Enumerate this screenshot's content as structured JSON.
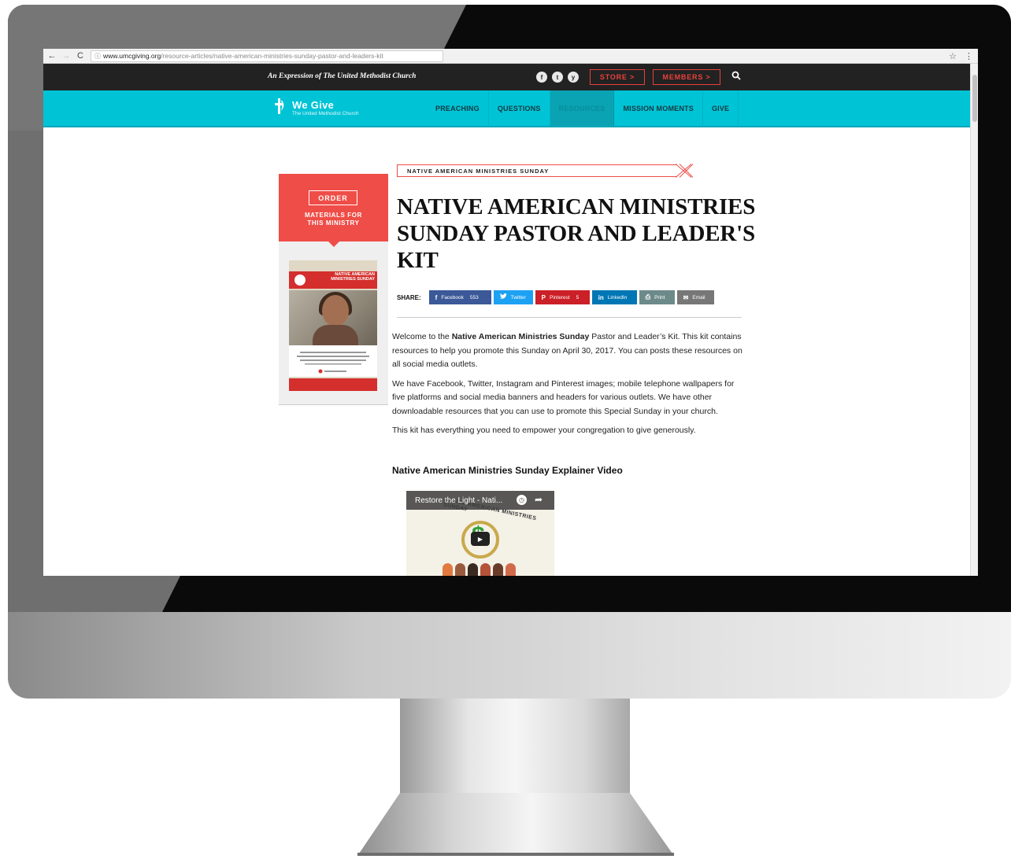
{
  "browser": {
    "url_host": "www.umcgiving.org",
    "url_path": "/resource-articles/native-american-ministries-sunday-pastor-and-leaders-kit"
  },
  "topbar": {
    "tagline": "An Expression of The United Methodist Church",
    "social": [
      "f",
      "t",
      "y"
    ],
    "store_label": "STORE >",
    "members_label": "MEMBERS >"
  },
  "nav": {
    "logo_title": "We Give",
    "logo_subtitle": "The United Methodist Church",
    "items": [
      "PREACHING",
      "QUESTIONS",
      "RESOURCES",
      "MISSION MOMENTS",
      "GIVE"
    ],
    "active": "RESOURCES"
  },
  "sidebar": {
    "order_label": "ORDER",
    "order_subtitle_1": "MATERIALS FOR",
    "order_subtitle_2": "THIS MINISTRY",
    "poster_title_1": "NATIVE AMERICAN",
    "poster_title_2": "MINISTRIES SUNDAY"
  },
  "article": {
    "category": "NATIVE AMERICAN MINISTRIES SUNDAY",
    "title": "NATIVE AMERICAN MINISTRIES SUNDAY PASTOR AND LEADER'S KIT",
    "share_label": "SHARE:",
    "share": {
      "facebook": "Facebook",
      "facebook_count": "553",
      "twitter": "Twitter",
      "pinterest": "Pinterest",
      "pinterest_count": "5",
      "linkedin": "LinkedIn",
      "print": "Print",
      "email": "Email"
    },
    "p1_a": "Welcome to the ",
    "p1_b": "Native American Ministries Sunday",
    "p1_c": " Pastor and Leader’s Kit. This kit contains resources to help you promote this Sunday on April 30, 2017. You can posts these resources on all social media outlets.",
    "p2": "We have Facebook, Twitter, Instagram and Pinterest images; mobile telephone wallpapers for five platforms and social media banners and headers for various outlets. We have other downloadable resources that you can use to promote this Special Sunday in your church.",
    "p3": "This kit has everything you need to empower your congregation to give generously.",
    "video_heading": "Native American Ministries Sunday Explainer Video",
    "video_title": "Restore the Light - Nati...",
    "video_arc": "NATIVE AMERICAN MINISTRIES SUNDAY"
  }
}
